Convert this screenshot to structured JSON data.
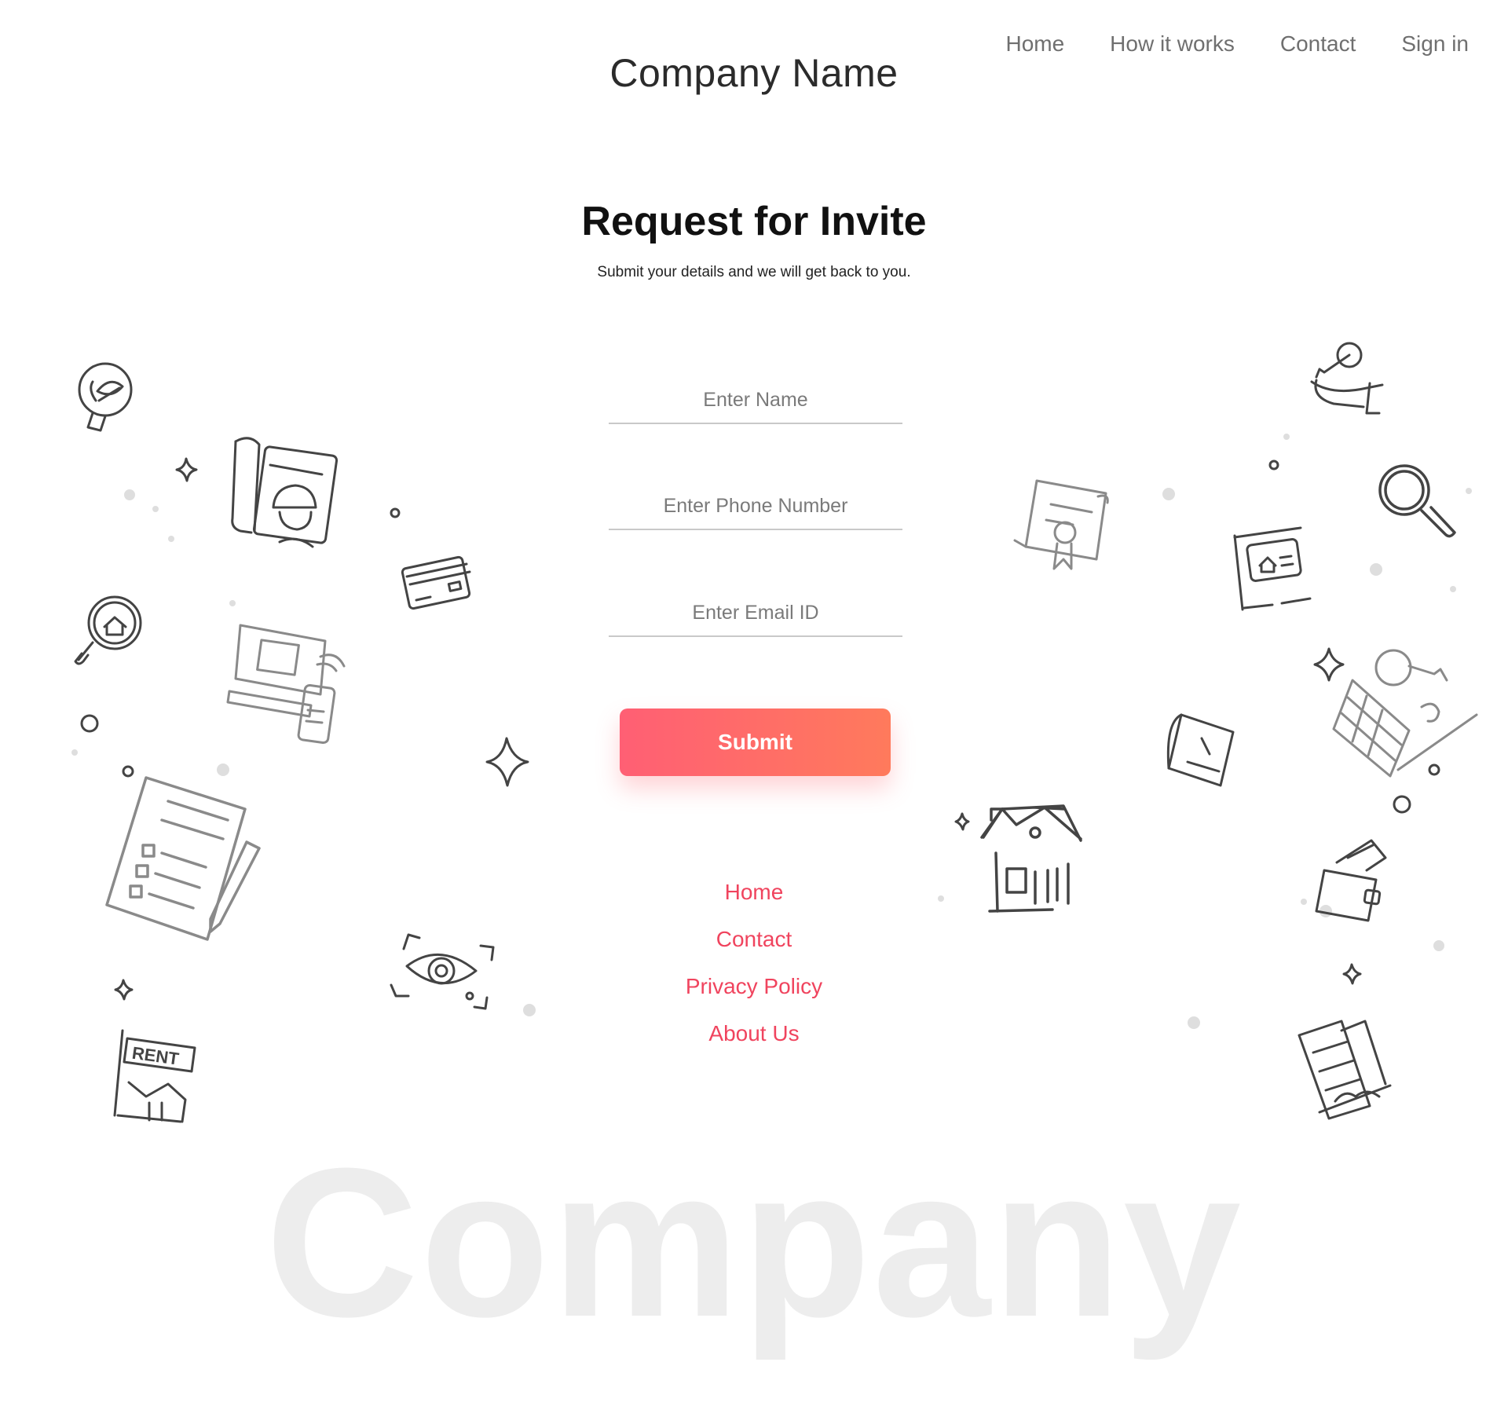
{
  "header": {
    "brand": "Company Name",
    "nav": [
      "Home",
      "How it works",
      "Contact",
      "Sign in"
    ]
  },
  "hero": {
    "title": "Request for Invite",
    "subtitle": "Submit your details and we will get back to you."
  },
  "form": {
    "name_placeholder": "Enter Name",
    "phone_placeholder": "Enter Phone Number",
    "email_placeholder": "Enter Email ID",
    "submit_label": "Submit"
  },
  "footer": {
    "links": [
      "Home",
      "Contact",
      "Privacy Policy",
      "About Us"
    ]
  },
  "watermark": "Company",
  "colors": {
    "accent": "#f0445e",
    "button_start": "#ff5f74",
    "button_end": "#ff7a5c",
    "icon_dark": "#444444",
    "icon_gray": "#8a8a8a"
  },
  "icons": [
    "bulb-leaf-icon",
    "sparkle-icon",
    "engineer-blueprint-icon",
    "credit-card-icon",
    "house-search-icon",
    "smart-home-devices-icon",
    "ring-icon",
    "contract-pen-icon",
    "sparkle-icon",
    "eye-scan-icon",
    "rent-sign-icon",
    "certificate-icon",
    "house-building-icon",
    "key-hand-icon",
    "magnifier-icon",
    "property-sign-icon",
    "building-key-icon",
    "floor-plan-icon",
    "wallet-icon",
    "skyscraper-icon"
  ]
}
